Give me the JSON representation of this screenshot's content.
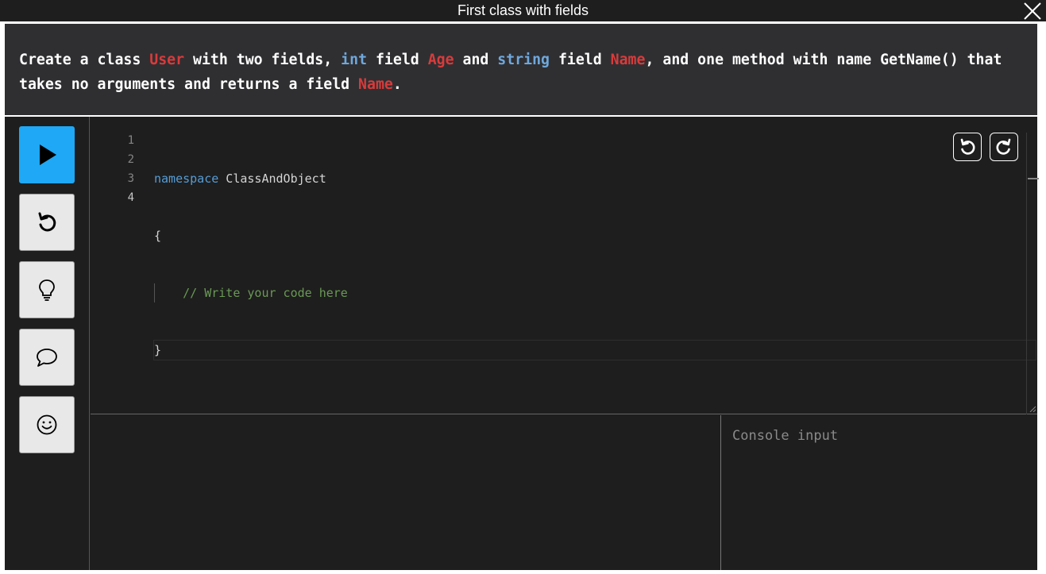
{
  "window": {
    "title": "First class with fields"
  },
  "task": {
    "segments": [
      {
        "text": "Create a class ",
        "style": "plain"
      },
      {
        "text": "User",
        "style": "red"
      },
      {
        "text": " with two fields, ",
        "style": "plain"
      },
      {
        "text": "int",
        "style": "blue"
      },
      {
        "text": " field ",
        "style": "plain"
      },
      {
        "text": "Age",
        "style": "red"
      },
      {
        "text": " and ",
        "style": "plain"
      },
      {
        "text": "string",
        "style": "blue"
      },
      {
        "text": " field ",
        "style": "plain"
      },
      {
        "text": "Name",
        "style": "red"
      },
      {
        "text": ", and one method with name GetName() that takes no arguments and returns a field ",
        "style": "plain"
      },
      {
        "text": "Name",
        "style": "red"
      },
      {
        "text": ".",
        "style": "plain"
      }
    ]
  },
  "toolbar": {
    "buttons": [
      {
        "name": "run-button",
        "icon": "play-icon"
      },
      {
        "name": "reset-button",
        "icon": "undo-icon"
      },
      {
        "name": "hint-button",
        "icon": "lightbulb-icon"
      },
      {
        "name": "chat-button",
        "icon": "speech-bubble-icon"
      },
      {
        "name": "feedback-button",
        "icon": "smiley-icon"
      }
    ]
  },
  "editor": {
    "line_numbers": [
      "1",
      "2",
      "3",
      "4"
    ],
    "lines": {
      "l1_keyword": "namespace",
      "l1_name": " ClassAndObject",
      "l2": "{",
      "l3_comment": "// Write your code here",
      "l4": "}"
    },
    "actions": [
      {
        "name": "editor-undo-button",
        "icon": "undo-icon"
      },
      {
        "name": "editor-redo-button",
        "icon": "redo-icon"
      }
    ]
  },
  "console": {
    "input_placeholder": "Console input",
    "input_value": ""
  },
  "colors": {
    "accent": "#1ea8f5",
    "highlight_red": "#d93b3b",
    "highlight_blue": "#6fa8dc",
    "keyword": "#569cd6",
    "comment": "#6a9955"
  }
}
